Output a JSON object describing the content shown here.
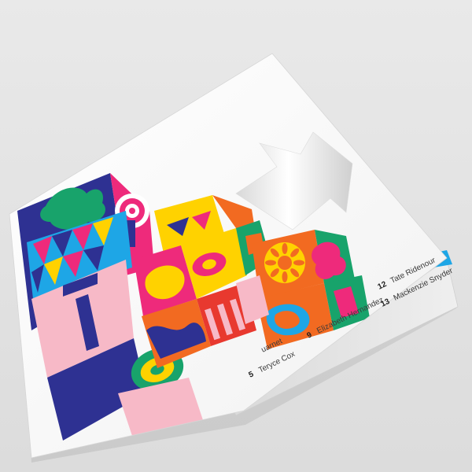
{
  "scene": {
    "background": "#e4e4e4",
    "subject": "folded square brochure mockup with colorful geometric cover art"
  },
  "palette": {
    "blue": "#2e3192",
    "pink": "#ee2a7b",
    "yellow": "#ffd200",
    "sky": "#1ea6e6",
    "green": "#18a36b",
    "orange": "#f26a21",
    "red": "#e8392f",
    "light_pink": "#f7b9c7",
    "paper": "#f8f8f8"
  },
  "credits": [
    {
      "num": "5",
      "name": "Teryce Cox"
    },
    {
      "num": "9",
      "name": "Elizabeth Hernandez"
    },
    {
      "num": "12",
      "name": "Tate Ridenour"
    },
    {
      "num": "13",
      "name": "Mackenzie Snyder"
    }
  ],
  "credits_partial": "uarnet"
}
